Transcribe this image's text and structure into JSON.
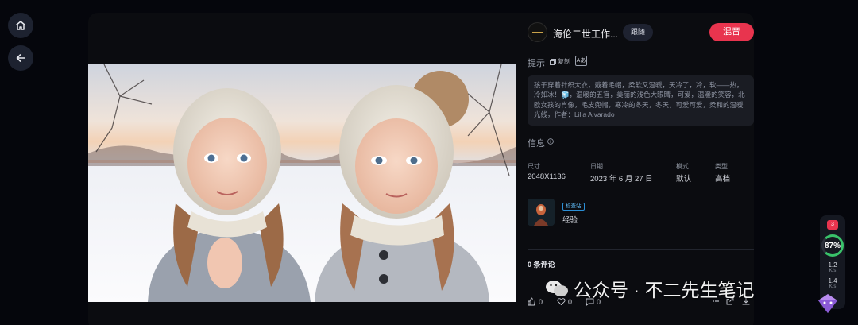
{
  "author": {
    "name": "海伦二世工作...",
    "follow_label": "跟随"
  },
  "remix_label": "混音",
  "prompt": {
    "title": "提示",
    "copy_label": "复制",
    "translate_icon": "Aあ",
    "text": "孩子穿着针织大衣，戴着毛帽，柔软又温暖，天冷了，冷，软——热，冷如冰！🧊，温暖的五官，美丽的浅色大眼睛，可爱，温暖的笑容，北欧女孩的肖像，毛皮兜帽，寒冷的冬天，冬天，可爱可爱，柔和的温暖光线，作者：Lilia Alvarado"
  },
  "info": {
    "title": "信息",
    "size_label": "尺寸",
    "size_value": "2048X1136",
    "date_label": "日期",
    "date_value": "2023 年 6 月 27 日",
    "mode_label": "模式",
    "mode_value": "默认",
    "type_label": "类型",
    "type_value": "高档"
  },
  "model": {
    "badge": "检查站",
    "name": "经验"
  },
  "comments": {
    "count_label": "0 条评论"
  },
  "actions": {
    "likes": "0",
    "hearts": "0",
    "comments": "0"
  },
  "side": {
    "level": "3",
    "percent": "87%",
    "up_rate": "1.2",
    "up_unit": "K/s",
    "down_rate": "1.4",
    "down_unit": "K/s"
  },
  "watermark": {
    "text": "公众号 · 不二先生笔记"
  },
  "colors": {
    "accent": "#e8344e",
    "panel": "#0b0c10",
    "background": "#05060c"
  }
}
